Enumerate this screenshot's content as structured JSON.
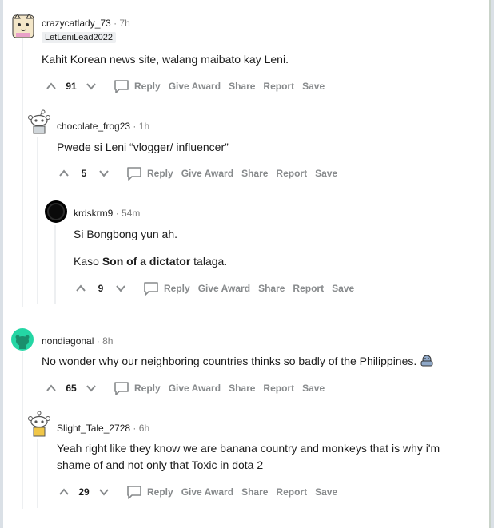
{
  "comments": [
    {
      "user": "crazycatlady_73",
      "time": "7h",
      "flair": "LetLeniLead2022",
      "text": "Kahit Korean news site, walang maibato kay Leni.",
      "score": "91"
    },
    {
      "user": "chocolate_frog23",
      "time": "1h",
      "text": "Pwede si Leni “vlogger/ influencer”",
      "score": "5"
    },
    {
      "user": "krdskrm9",
      "time": "54m",
      "text1": "Si Bongbong yun ah.",
      "text2_pre": "Kaso ",
      "text2_bold": "Son of a dictator",
      "text2_post": " talaga.",
      "score": "9"
    },
    {
      "user": "nondiagonal",
      "time": "8h",
      "text": "No wonder why our neighboring countries thinks so badly of the Philippines.",
      "score": "65"
    },
    {
      "user": "Slight_Tale_2728",
      "time": "6h",
      "text": "Yeah right like they know we are banana country and monkeys that is why i'm shame of and not only that Toxic in dota 2",
      "score": "29"
    }
  ],
  "actions": {
    "reply": "Reply",
    "award": "Give Award",
    "share": "Share",
    "report": "Report",
    "save": "Save"
  },
  "meta": {
    "dot": "·"
  },
  "colors": {
    "accent_avatar": "#24d6a4",
    "muted": "#878a8c",
    "text": "#1c1c1c",
    "line": "#edeff1"
  }
}
